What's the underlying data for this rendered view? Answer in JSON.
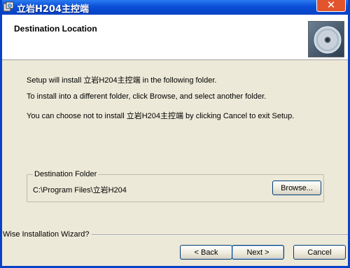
{
  "window": {
    "title": "立岩H204主控端",
    "close_glyph": "✕"
  },
  "header": {
    "title": "Destination Location",
    "image_icon": "cd-disc-icon"
  },
  "body": {
    "line1": "Setup will install 立岩H204主控端 in the following folder.",
    "line2": "To install into a different folder, click Browse, and select another folder.",
    "line3": "You can choose not to install 立岩H204主控端 by clicking Cancel to exit Setup."
  },
  "destination": {
    "group_label": "Destination Folder",
    "path": "C:\\Program Files\\立岩H204",
    "browse_label": "Browse..."
  },
  "footer": {
    "wizard_label": "Wise Installation Wizard?",
    "back_label": "< Back",
    "next_label": "Next >",
    "cancel_label": "Cancel"
  }
}
